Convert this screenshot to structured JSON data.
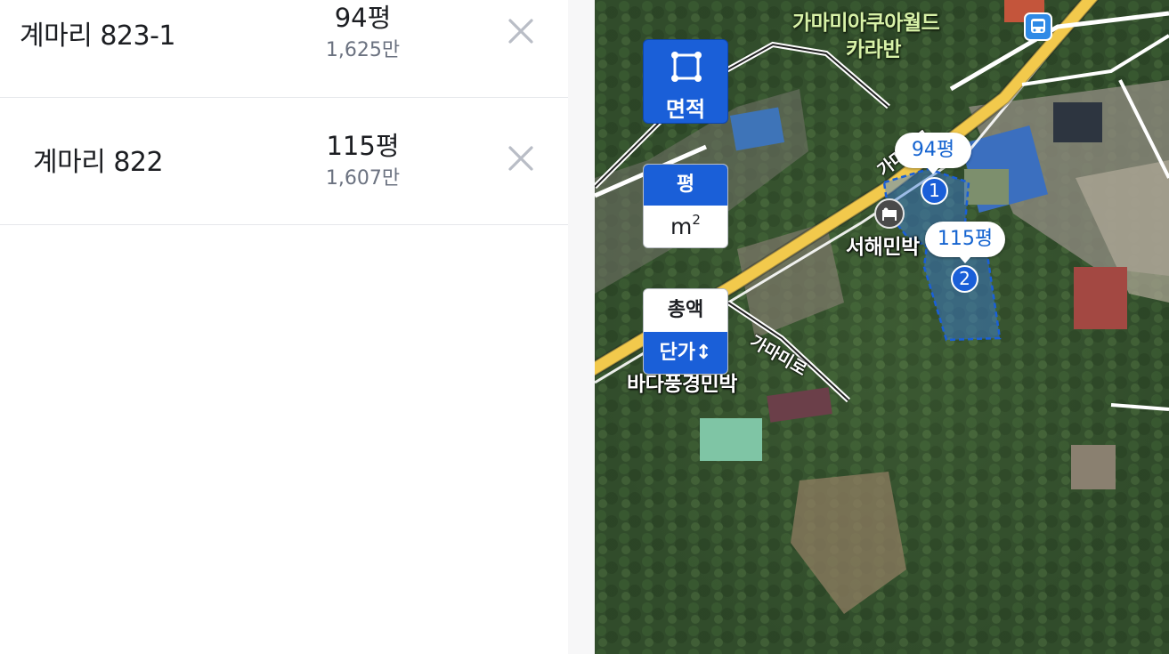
{
  "list": {
    "rows": [
      {
        "address": "계마리 823-1",
        "area": "94평",
        "price": "1,625만"
      },
      {
        "address": "계마리 822",
        "area": "115평",
        "price": "1,607만"
      }
    ]
  },
  "map": {
    "controls": {
      "area_tool": {
        "label": "면적",
        "icon": "square-select-icon"
      },
      "unit_toggle": {
        "active": "평",
        "inactive_base": "m",
        "inactive_sup": "2"
      },
      "price_toggle": {
        "inactive": "총액",
        "active": "단가↕"
      }
    },
    "labels": {
      "poi_park_line1": "가마미아쿠아월드",
      "poi_park_line2": "카라반",
      "poi_lodging": "서해민박",
      "poi_lodging2": "바다풍경민박",
      "road_main": "가마미로",
      "road_small": "가마미로"
    },
    "parcels": [
      {
        "bubble": "94평",
        "number": "1"
      },
      {
        "bubble": "115평",
        "number": "2"
      }
    ],
    "icons": [
      "bus-stop-icon",
      "lodging-icon"
    ],
    "colors": {
      "accent": "#1a5fd8",
      "road": "#f2c94c",
      "parcel_fill": "#3b7fe0"
    }
  }
}
